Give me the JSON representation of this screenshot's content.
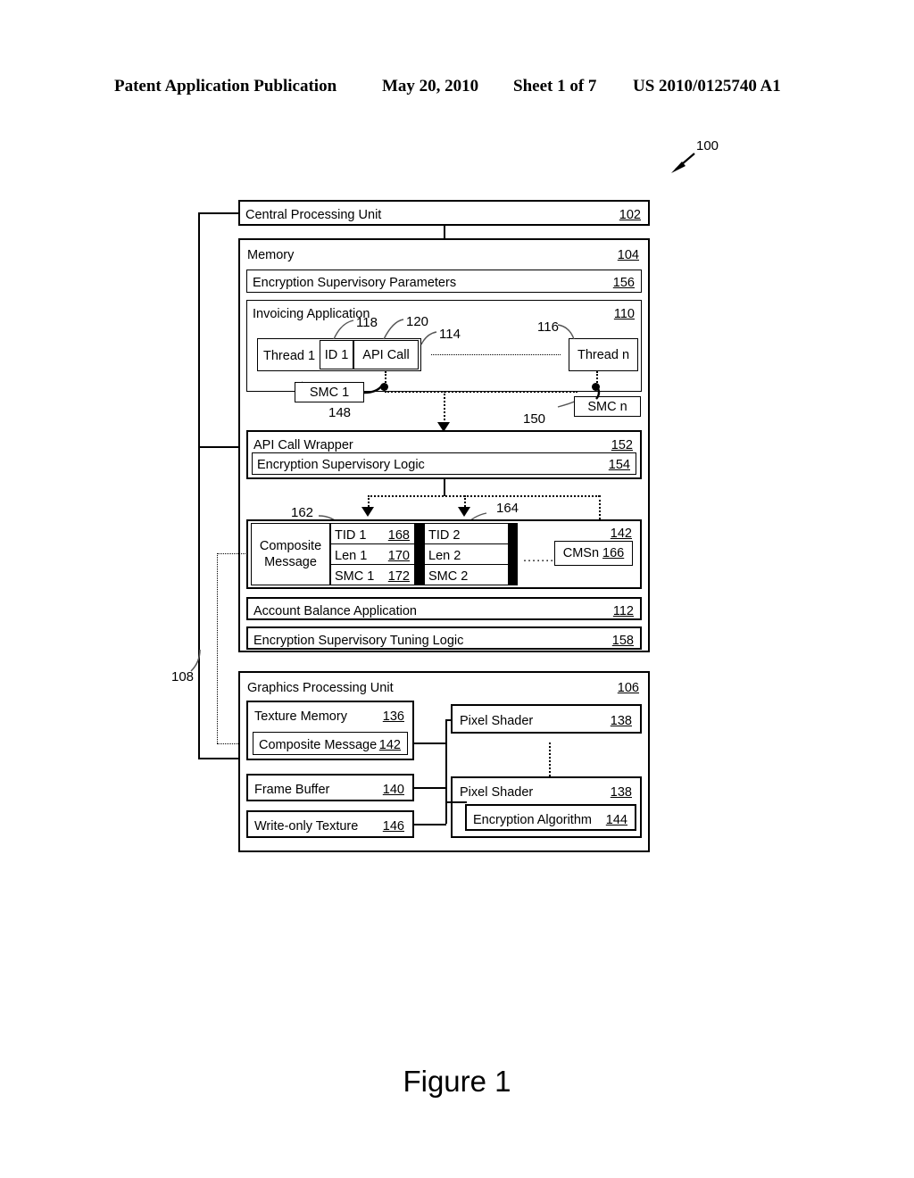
{
  "header": {
    "publication": "Patent Application Publication",
    "date": "May 20, 2010",
    "sheet": "Sheet 1 of 7",
    "pub_number": "US 2010/0125740 A1"
  },
  "figure": {
    "caption": "Figure 1",
    "system_ref": "100",
    "bus_ref": "108"
  },
  "cpu": {
    "label": "Central Processing Unit",
    "ref": "102"
  },
  "memory": {
    "label": "Memory",
    "ref": "104"
  },
  "encryption_params": {
    "label": "Encryption Supervisory Parameters",
    "ref": "156"
  },
  "invoicing_app": {
    "label": "Invoicing Application",
    "ref": "110",
    "thread1": {
      "label": "Thread 1",
      "ref": "114",
      "id_label": "ID 1",
      "id_ref": "118",
      "api_label": "API Call",
      "api_ref": "120"
    },
    "threadn": {
      "label": "Thread n",
      "ref": "116"
    },
    "smc1": {
      "label": "SMC 1",
      "ref": "148"
    },
    "smcn": {
      "label": "SMC n",
      "ref": "150"
    }
  },
  "api_wrapper": {
    "label": "API Call Wrapper",
    "ref": "152",
    "logic_label": "Encryption Supervisory Logic",
    "logic_ref": "154"
  },
  "composite_message": {
    "label_line1": "Composite",
    "label_line2": "Message",
    "ref": "142",
    "arrow_ref_left": "162",
    "arrow_ref_right": "164",
    "columns": [
      {
        "tid": "TID 1",
        "tid_ref": "168",
        "len": "Len 1",
        "len_ref": "170",
        "smc": "SMC 1",
        "smc_ref": "172"
      },
      {
        "tid": "TID 2",
        "tid_ref": "",
        "len": "Len 2",
        "len_ref": "",
        "smc": "SMC 2",
        "smc_ref": ""
      }
    ],
    "ellipsis": "........",
    "cmsn_label": "CMSn",
    "cmsn_ref": "166"
  },
  "account_balance_app": {
    "label": "Account Balance Application",
    "ref": "112"
  },
  "tuning_logic": {
    "label": "Encryption Supervisory Tuning Logic",
    "ref": "158"
  },
  "gpu": {
    "label": "Graphics Processing Unit",
    "ref": "106",
    "texture_memory": {
      "label": "Texture Memory",
      "ref": "136"
    },
    "gpu_composite_message": {
      "label": "Composite Message",
      "ref": "142"
    },
    "frame_buffer": {
      "label": "Frame Buffer",
      "ref": "140"
    },
    "write_only_texture": {
      "label": "Write-only Texture",
      "ref": "146"
    },
    "pixel_shader_top": {
      "label": "Pixel Shader",
      "ref": "138"
    },
    "pixel_shader_bottom": {
      "label": "Pixel Shader",
      "ref": "138"
    },
    "encryption_algorithm": {
      "label": "Encryption Algorithm",
      "ref": "144"
    }
  }
}
